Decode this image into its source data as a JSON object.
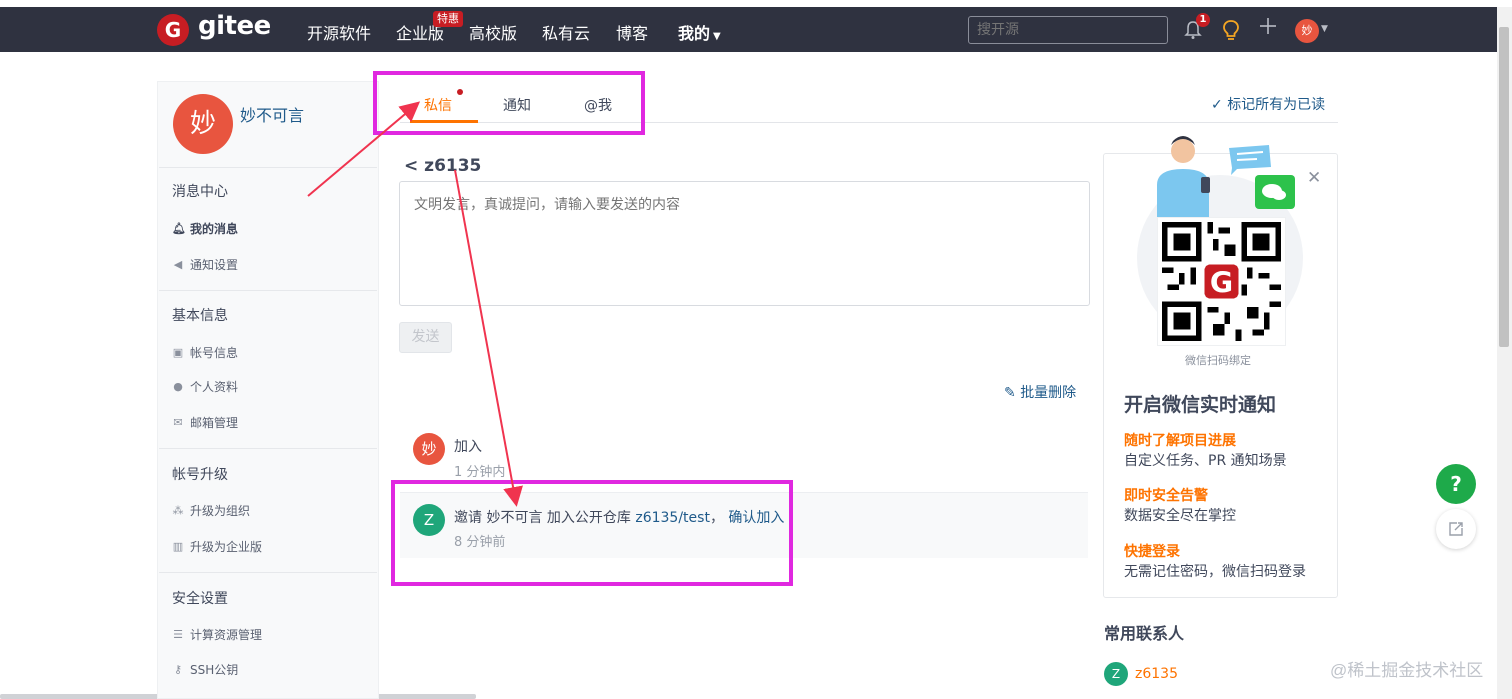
{
  "navbar": {
    "logo_letter": "G",
    "logo_text": "gitee",
    "items": [
      "开源软件",
      "企业版",
      "高校版",
      "私有云",
      "博客"
    ],
    "badge": "特惠",
    "mine_label": "我的",
    "search_placeholder": "搜开源",
    "notification_count": "1",
    "user_avatar": "妙"
  },
  "sidebar": {
    "avatar": "妙",
    "username": "妙不可言",
    "groups": [
      {
        "title": "消息中心",
        "items": [
          "我的消息",
          "通知设置"
        ]
      },
      {
        "title": "基本信息",
        "items": [
          "帐号信息",
          "个人资料",
          "邮箱管理"
        ]
      },
      {
        "title": "帐号升级",
        "items": [
          "升级为组织",
          "升级为企业版"
        ]
      },
      {
        "title": "安全设置",
        "items": [
          "计算资源管理",
          "SSH公钥"
        ]
      }
    ]
  },
  "tabs": [
    "私信",
    "通知",
    "@我"
  ],
  "mark_all_read": "标记所有为已读",
  "conversation": {
    "title": "z6135",
    "input_placeholder": "文明发言，真诚提问，请输入要发送的内容",
    "send_label": "发送",
    "batch_delete": "批量删除",
    "messages": [
      {
        "avatar": "妙",
        "text": "加入",
        "time": "1 分钟内"
      },
      {
        "avatar": "Z",
        "text_prefix": "邀请 妙不可言 加入公开仓库",
        "repo": "z6135/test",
        "separator": "，",
        "action": "确认加入",
        "time": "8 分钟前"
      }
    ]
  },
  "wechat_card": {
    "qr_label": "微信扫码绑定",
    "title": "开启微信实时通知",
    "features": [
      {
        "title": "随时了解项目进展",
        "desc": "自定义任务、PR 通知场景"
      },
      {
        "title": "即时安全告警",
        "desc": "数据安全尽在掌控"
      },
      {
        "title": "快捷登录",
        "desc": "无需记住密码，微信扫码登录"
      }
    ]
  },
  "contacts": {
    "title": "常用联系人",
    "items": [
      {
        "avatar": "Z",
        "name": "z6135"
      }
    ]
  },
  "help_label": "?",
  "watermark": "@稀土掘金技术社区",
  "colors": {
    "navbar": "#2f3240",
    "brand_red": "#c71d23",
    "accent_orange": "#fe7300",
    "link_blue": "#1f5a8a",
    "annotation_magenta": "#e028e0",
    "annotation_arrow": "#f0344f",
    "help_green": "#1eaa4a"
  }
}
